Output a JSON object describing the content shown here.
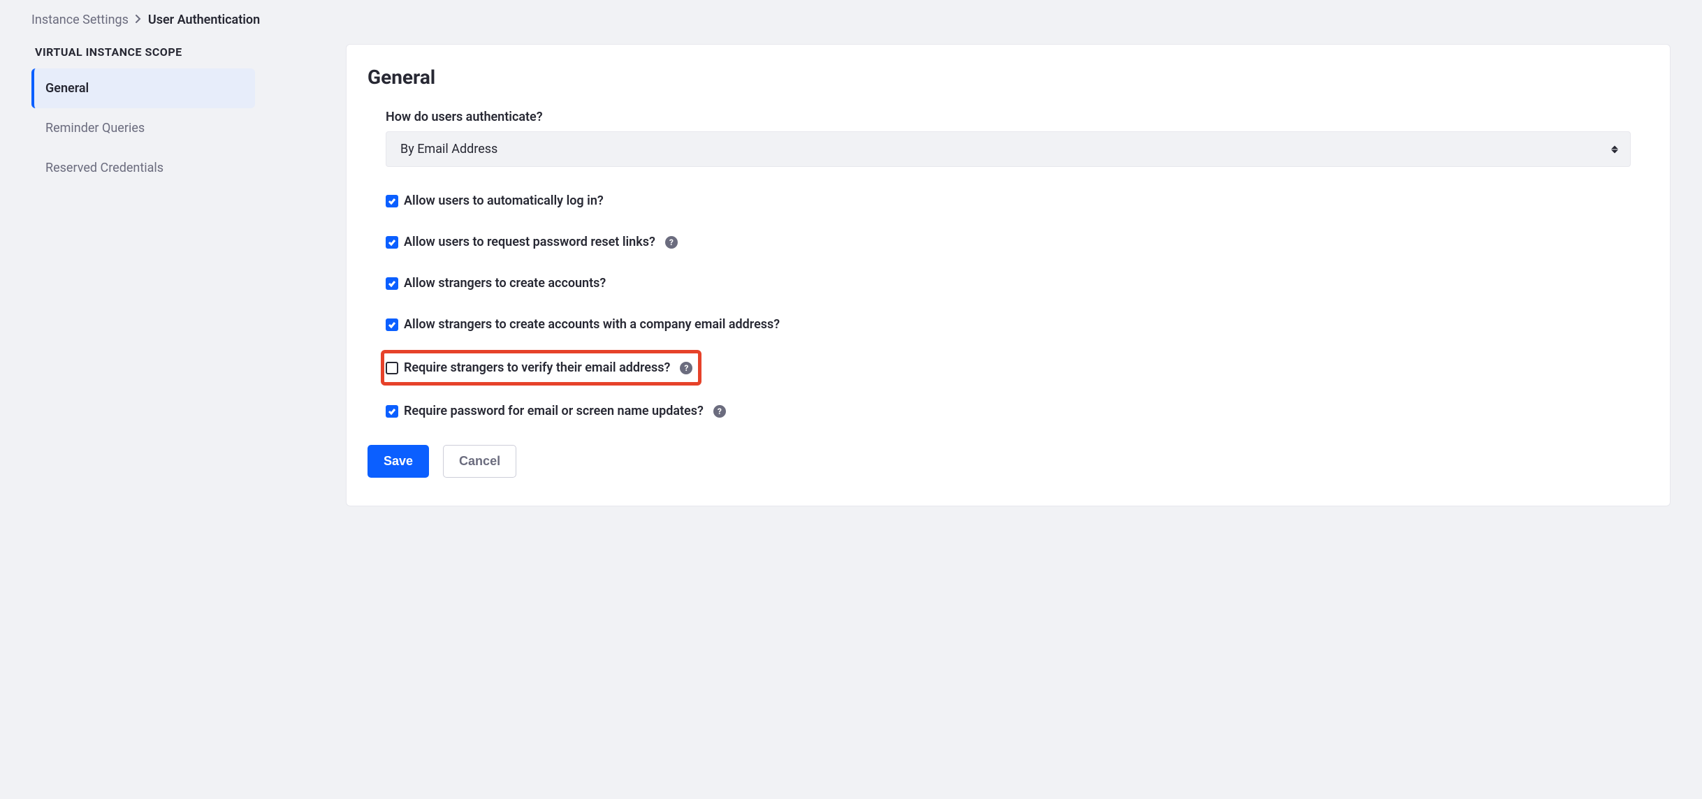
{
  "breadcrumb": {
    "parent": "Instance Settings",
    "current": "User Authentication"
  },
  "sidebar": {
    "title": "VIRTUAL INSTANCE SCOPE",
    "items": [
      {
        "label": "General",
        "active": true
      },
      {
        "label": "Reminder Queries",
        "active": false
      },
      {
        "label": "Reserved Credentials",
        "active": false
      }
    ]
  },
  "panel": {
    "title": "General",
    "auth_label": "How do users authenticate?",
    "auth_value": "By Email Address",
    "checkboxes": [
      {
        "label": "Allow users to automatically log in?",
        "checked": true,
        "help": false,
        "highlighted": false
      },
      {
        "label": "Allow users to request password reset links?",
        "checked": true,
        "help": true,
        "highlighted": false
      },
      {
        "label": "Allow strangers to create accounts?",
        "checked": true,
        "help": false,
        "highlighted": false
      },
      {
        "label": "Allow strangers to create accounts with a company email address?",
        "checked": true,
        "help": false,
        "highlighted": false
      },
      {
        "label": "Require strangers to verify their email address?",
        "checked": false,
        "help": true,
        "highlighted": true
      },
      {
        "label": "Require password for email or screen name updates?",
        "checked": true,
        "help": true,
        "highlighted": false
      }
    ],
    "buttons": {
      "save": "Save",
      "cancel": "Cancel"
    }
  }
}
